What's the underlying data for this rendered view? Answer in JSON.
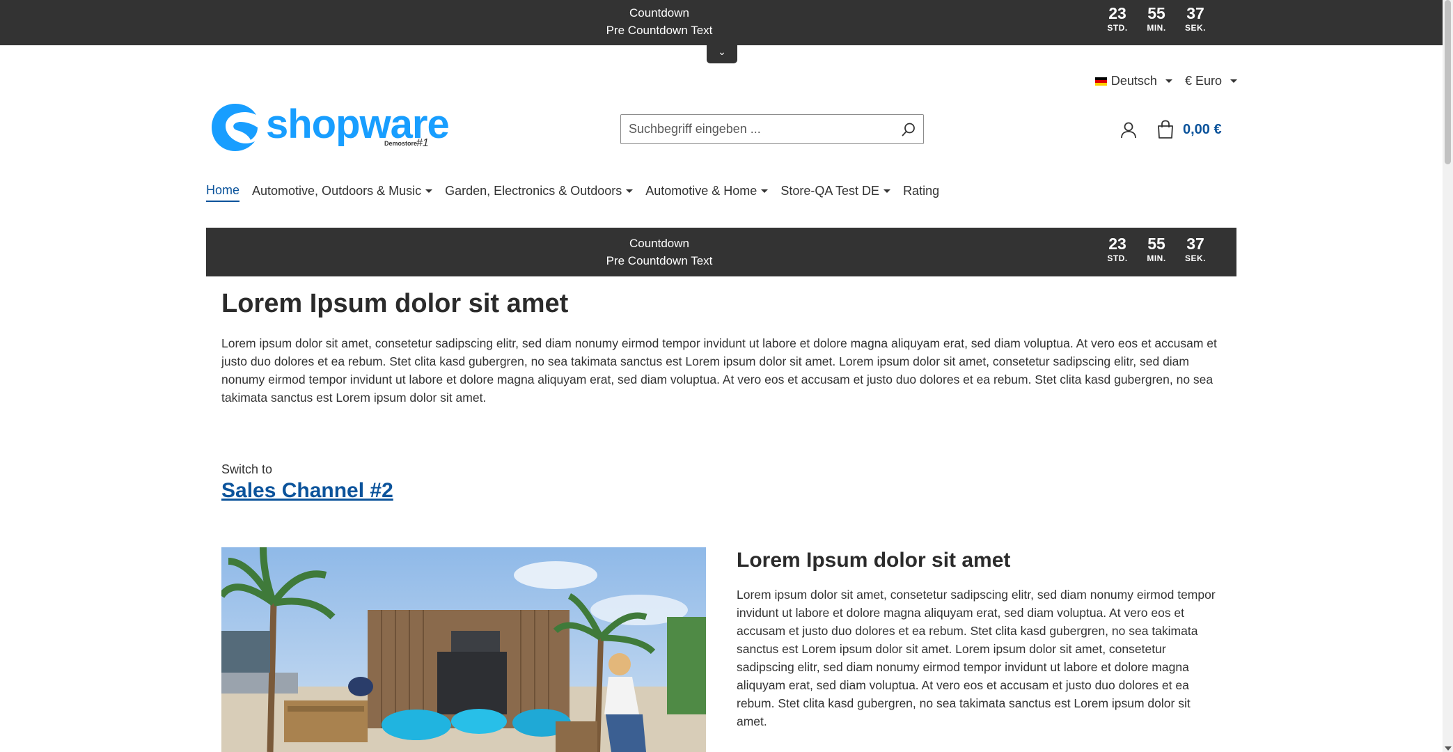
{
  "countdown": {
    "title": "Countdown",
    "subtitle": "Pre Countdown Text",
    "hours": "23",
    "minutes": "55",
    "seconds": "37",
    "hours_label": "STD.",
    "minutes_label": "MIN.",
    "seconds_label": "SEK."
  },
  "header": {
    "language": "Deutsch",
    "currency": "€ Euro",
    "logo_text": "shopware",
    "logo_sub": "Demostore",
    "logo_num": "#1",
    "search_placeholder": "Suchbegriff eingeben ...",
    "cart_total": "0,00 €"
  },
  "nav": {
    "items": [
      {
        "label": "Home"
      },
      {
        "label": "Automotive, Outdoors & Music"
      },
      {
        "label": "Garden, Electronics & Outdoors"
      },
      {
        "label": "Automotive & Home"
      },
      {
        "label": "Store-QA Test DE"
      },
      {
        "label": "Rating"
      }
    ]
  },
  "content": {
    "heading": "Lorem Ipsum dolor sit amet",
    "paragraph": "Lorem ipsum dolor sit amet, consetetur sadipscing elitr, sed diam nonumy eirmod tempor invidunt ut labore et dolore magna aliquyam erat, sed diam voluptua. At vero eos et accusam et justo duo dolores et ea rebum. Stet clita kasd gubergren, no sea takimata sanctus est Lorem ipsum dolor sit amet. Lorem ipsum dolor sit amet, consetetur sadipscing elitr, sed diam nonumy eirmod tempor invidunt ut labore et dolore magna aliquyam erat, sed diam voluptua. At vero eos et accusam et justo duo dolores et ea rebum. Stet clita kasd gubergren, no sea takimata sanctus est Lorem ipsum dolor sit amet.",
    "switch_to": "Switch to",
    "sales_channel_link": "Sales Channel #2",
    "section_heading": "Lorem Ipsum dolor sit amet",
    "section_paragraph": "Lorem ipsum dolor sit amet, consetetur sadipscing elitr, sed diam nonumy eirmod tempor invidunt ut labore et dolore magna aliquyam erat, sed diam voluptua. At vero eos et accusam et justo duo dolores et ea rebum. Stet clita kasd gubergren, no sea takimata sanctus est Lorem ipsum dolor sit amet. Lorem ipsum dolor sit amet, consetetur sadipscing elitr, sed diam nonumy eirmod tempor invidunt ut labore et dolore magna aliquyam erat, sed diam voluptua. At vero eos et accusam et justo duo dolores et ea rebum. Stet clita kasd gubergren, no sea takimata sanctus est Lorem ipsum dolor sit amet."
  },
  "colors": {
    "countdown_bg": "#333333",
    "brand_blue": "#189eff",
    "link_blue": "#0b539b"
  },
  "icons": [
    "chevron-down-icon",
    "flag-de-icon",
    "search-icon",
    "user-icon",
    "cart-icon"
  ]
}
